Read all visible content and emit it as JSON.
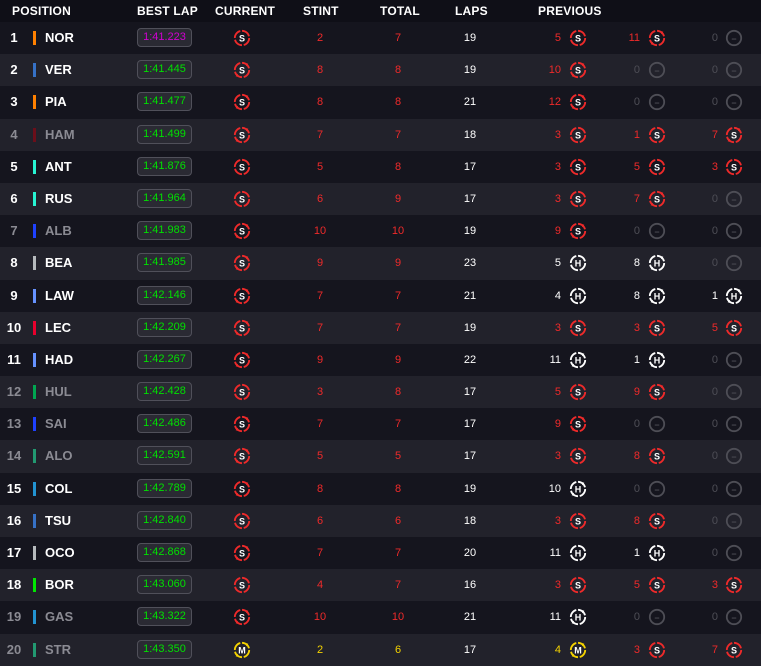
{
  "header": {
    "position": "POSITION",
    "best_lap": "BEST LAP",
    "current": "CURRENT",
    "stint": "STINT",
    "total": "TOTAL",
    "laps": "LAPS",
    "previous": "PREVIOUS"
  },
  "tyre_letters": {
    "soft": "S",
    "medium": "M",
    "hard": "H",
    "none": "–"
  },
  "colors": {
    "soft": "#ef2a2a",
    "medium": "#f5d300",
    "hard": "#ffffff",
    "none": "#4e4e56",
    "best_lap_green": "#00e000",
    "best_lap_purple": "#d100d1"
  },
  "rows": [
    {
      "pos": "1",
      "code": "NOR",
      "team_color": "#ff8000",
      "dim": false,
      "best_lap": "1:41.223",
      "best_purple": true,
      "current": "soft",
      "current_new": false,
      "stint": "2",
      "total": "7",
      "laps": "19",
      "prev": [
        {
          "n": "5",
          "t": "soft",
          "new": false
        },
        {
          "n": "11",
          "t": "soft",
          "new": true
        },
        {
          "n": "0",
          "t": "none",
          "new": false
        }
      ]
    },
    {
      "pos": "2",
      "code": "VER",
      "team_color": "#3671c6",
      "dim": false,
      "best_lap": "1:41.445",
      "best_purple": false,
      "current": "soft",
      "current_new": true,
      "stint": "8",
      "total": "8",
      "laps": "19",
      "prev": [
        {
          "n": "10",
          "t": "soft",
          "new": true
        },
        {
          "n": "0",
          "t": "none",
          "new": false
        },
        {
          "n": "0",
          "t": "none",
          "new": false
        }
      ]
    },
    {
      "pos": "3",
      "code": "PIA",
      "team_color": "#ff8000",
      "dim": false,
      "best_lap": "1:41.477",
      "best_purple": false,
      "current": "soft",
      "current_new": true,
      "stint": "8",
      "total": "8",
      "laps": "21",
      "prev": [
        {
          "n": "12",
          "t": "soft",
          "new": true
        },
        {
          "n": "0",
          "t": "none",
          "new": false
        },
        {
          "n": "0",
          "t": "none",
          "new": false
        }
      ]
    },
    {
      "pos": "4",
      "code": "HAM",
      "team_color": "#6b0f1a",
      "dim": true,
      "best_lap": "1:41.499",
      "best_purple": false,
      "current": "soft",
      "current_new": true,
      "stint": "7",
      "total": "7",
      "laps": "18",
      "prev": [
        {
          "n": "3",
          "t": "soft",
          "new": false
        },
        {
          "n": "1",
          "t": "soft",
          "new": false
        },
        {
          "n": "7",
          "t": "soft",
          "new": true
        }
      ]
    },
    {
      "pos": "5",
      "code": "ANT",
      "team_color": "#27f4d2",
      "dim": false,
      "best_lap": "1:41.876",
      "best_purple": false,
      "current": "soft",
      "current_new": false,
      "stint": "5",
      "total": "8",
      "laps": "17",
      "prev": [
        {
          "n": "3",
          "t": "soft",
          "new": false
        },
        {
          "n": "5",
          "t": "soft",
          "new": false
        },
        {
          "n": "3",
          "t": "soft",
          "new": false
        }
      ]
    },
    {
      "pos": "6",
      "code": "RUS",
      "team_color": "#27f4d2",
      "dim": false,
      "best_lap": "1:41.964",
      "best_purple": false,
      "current": "soft",
      "current_new": false,
      "stint": "6",
      "total": "9",
      "laps": "17",
      "prev": [
        {
          "n": "3",
          "t": "soft",
          "new": false
        },
        {
          "n": "7",
          "t": "soft",
          "new": true
        },
        {
          "n": "0",
          "t": "none",
          "new": false
        }
      ]
    },
    {
      "pos": "7",
      "code": "ALB",
      "team_color": "#1e41ff",
      "dim": true,
      "best_lap": "1:41.983",
      "best_purple": false,
      "current": "soft",
      "current_new": true,
      "stint": "10",
      "total": "10",
      "laps": "19",
      "prev": [
        {
          "n": "9",
          "t": "soft",
          "new": true
        },
        {
          "n": "0",
          "t": "none",
          "new": false
        },
        {
          "n": "0",
          "t": "none",
          "new": false
        }
      ]
    },
    {
      "pos": "8",
      "code": "BEA",
      "team_color": "#b6babd",
      "dim": false,
      "best_lap": "1:41.985",
      "best_purple": false,
      "current": "soft",
      "current_new": true,
      "stint": "9",
      "total": "9",
      "laps": "23",
      "prev": [
        {
          "n": "5",
          "t": "hard",
          "new": false
        },
        {
          "n": "8",
          "t": "hard",
          "new": true
        },
        {
          "n": "0",
          "t": "none",
          "new": false
        }
      ]
    },
    {
      "pos": "9",
      "code": "LAW",
      "team_color": "#6692ff",
      "dim": false,
      "best_lap": "1:42.146",
      "best_purple": false,
      "current": "soft",
      "current_new": true,
      "stint": "7",
      "total": "7",
      "laps": "21",
      "prev": [
        {
          "n": "4",
          "t": "hard",
          "new": false
        },
        {
          "n": "8",
          "t": "hard",
          "new": true
        },
        {
          "n": "1",
          "t": "hard",
          "new": true
        }
      ]
    },
    {
      "pos": "10",
      "code": "LEC",
      "team_color": "#e8002d",
      "dim": false,
      "best_lap": "1:42.209",
      "best_purple": false,
      "current": "soft",
      "current_new": true,
      "stint": "7",
      "total": "7",
      "laps": "19",
      "prev": [
        {
          "n": "3",
          "t": "soft",
          "new": false
        },
        {
          "n": "3",
          "t": "soft",
          "new": false
        },
        {
          "n": "5",
          "t": "soft",
          "new": false
        }
      ]
    },
    {
      "pos": "11",
      "code": "HAD",
      "team_color": "#6692ff",
      "dim": false,
      "best_lap": "1:42.267",
      "best_purple": false,
      "current": "soft",
      "current_new": true,
      "stint": "9",
      "total": "9",
      "laps": "22",
      "prev": [
        {
          "n": "11",
          "t": "hard",
          "new": true
        },
        {
          "n": "1",
          "t": "hard",
          "new": true
        },
        {
          "n": "0",
          "t": "none",
          "new": false
        }
      ]
    },
    {
      "pos": "12",
      "code": "HUL",
      "team_color": "#00a651",
      "dim": true,
      "best_lap": "1:42.428",
      "best_purple": false,
      "current": "soft",
      "current_new": false,
      "stint": "3",
      "total": "8",
      "laps": "17",
      "prev": [
        {
          "n": "5",
          "t": "soft",
          "new": false
        },
        {
          "n": "9",
          "t": "soft",
          "new": true
        },
        {
          "n": "0",
          "t": "none",
          "new": false
        }
      ]
    },
    {
      "pos": "13",
      "code": "SAI",
      "team_color": "#1e41ff",
      "dim": true,
      "best_lap": "1:42.486",
      "best_purple": false,
      "current": "soft",
      "current_new": true,
      "stint": "7",
      "total": "7",
      "laps": "17",
      "prev": [
        {
          "n": "9",
          "t": "soft",
          "new": true
        },
        {
          "n": "0",
          "t": "none",
          "new": false
        },
        {
          "n": "0",
          "t": "none",
          "new": false
        }
      ]
    },
    {
      "pos": "14",
      "code": "ALO",
      "team_color": "#229971",
      "dim": true,
      "best_lap": "1:42.591",
      "best_purple": false,
      "current": "soft",
      "current_new": true,
      "stint": "5",
      "total": "5",
      "laps": "17",
      "prev": [
        {
          "n": "3",
          "t": "soft",
          "new": false
        },
        {
          "n": "8",
          "t": "soft",
          "new": false
        },
        {
          "n": "0",
          "t": "none",
          "new": false
        }
      ]
    },
    {
      "pos": "15",
      "code": "COL",
      "team_color": "#2293d1",
      "dim": false,
      "best_lap": "1:42.789",
      "best_purple": false,
      "current": "soft",
      "current_new": true,
      "stint": "8",
      "total": "8",
      "laps": "19",
      "prev": [
        {
          "n": "10",
          "t": "hard",
          "new": true
        },
        {
          "n": "0",
          "t": "none",
          "new": false
        },
        {
          "n": "0",
          "t": "none",
          "new": false
        }
      ]
    },
    {
      "pos": "16",
      "code": "TSU",
      "team_color": "#3671c6",
      "dim": false,
      "best_lap": "1:42.840",
      "best_purple": false,
      "current": "soft",
      "current_new": false,
      "stint": "6",
      "total": "6",
      "laps": "18",
      "prev": [
        {
          "n": "3",
          "t": "soft",
          "new": false
        },
        {
          "n": "8",
          "t": "soft",
          "new": false
        },
        {
          "n": "0",
          "t": "none",
          "new": false
        }
      ]
    },
    {
      "pos": "17",
      "code": "OCO",
      "team_color": "#b6babd",
      "dim": false,
      "best_lap": "1:42.868",
      "best_purple": false,
      "current": "soft",
      "current_new": true,
      "stint": "7",
      "total": "7",
      "laps": "20",
      "prev": [
        {
          "n": "11",
          "t": "hard",
          "new": false
        },
        {
          "n": "1",
          "t": "hard",
          "new": true
        },
        {
          "n": "0",
          "t": "none",
          "new": false
        }
      ]
    },
    {
      "pos": "18",
      "code": "BOR",
      "team_color": "#00e701",
      "dim": false,
      "best_lap": "1:43.060",
      "best_purple": false,
      "current": "soft",
      "current_new": false,
      "stint": "4",
      "total": "7",
      "laps": "16",
      "prev": [
        {
          "n": "3",
          "t": "soft",
          "new": false
        },
        {
          "n": "5",
          "t": "soft",
          "new": false
        },
        {
          "n": "3",
          "t": "soft",
          "new": false
        }
      ]
    },
    {
      "pos": "19",
      "code": "GAS",
      "team_color": "#2293d1",
      "dim": true,
      "best_lap": "1:43.322",
      "best_purple": false,
      "current": "soft",
      "current_new": true,
      "stint": "10",
      "total": "10",
      "laps": "21",
      "prev": [
        {
          "n": "11",
          "t": "hard",
          "new": true
        },
        {
          "n": "0",
          "t": "none",
          "new": false
        },
        {
          "n": "0",
          "t": "none",
          "new": false
        }
      ]
    },
    {
      "pos": "20",
      "code": "STR",
      "team_color": "#229971",
      "dim": true,
      "best_lap": "1:43.350",
      "best_purple": false,
      "current": "medium",
      "current_new": true,
      "stint": "2",
      "total": "6",
      "laps": "17",
      "prev": [
        {
          "n": "4",
          "t": "medium",
          "new": true
        },
        {
          "n": "3",
          "t": "soft",
          "new": false
        },
        {
          "n": "7",
          "t": "soft",
          "new": false
        }
      ]
    }
  ]
}
